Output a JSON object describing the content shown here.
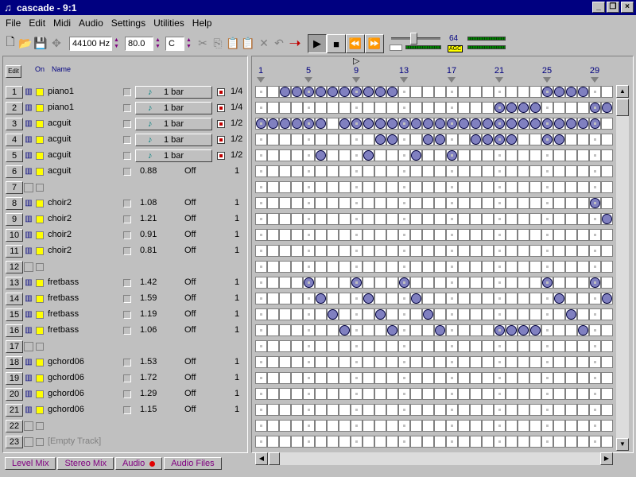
{
  "window": {
    "title": "cascade - 9:1"
  },
  "menu": [
    "File",
    "Edit",
    "Midi",
    "Audio",
    "Settings",
    "Utilities",
    "Help"
  ],
  "toolbar": {
    "sample_rate": "44100 Hz",
    "tempo": "80.0",
    "key": "C",
    "level_value": "64",
    "agc_label": "AGC"
  },
  "track_header": {
    "edit_label": "Edit",
    "on_label": "On",
    "name_label": "Name"
  },
  "tracks": [
    {
      "num": "1",
      "name": "piano1",
      "type": "midi",
      "len": "1 bar",
      "frac": "1/4"
    },
    {
      "num": "2",
      "name": "piano1",
      "type": "midi",
      "len": "1 bar",
      "frac": "1/4"
    },
    {
      "num": "3",
      "name": "acguit",
      "type": "midi",
      "len": "1 bar",
      "frac": "1/2"
    },
    {
      "num": "4",
      "name": "acguit",
      "type": "midi",
      "len": "1 bar",
      "frac": "1/2"
    },
    {
      "num": "5",
      "name": "acguit",
      "type": "midi",
      "len": "1 bar",
      "frac": "1/2"
    },
    {
      "num": "6",
      "name": "acguit",
      "type": "audio",
      "val": "0.88",
      "off": "Off",
      "one": "1"
    },
    {
      "num": "7",
      "name": "",
      "type": "none"
    },
    {
      "num": "8",
      "name": "choir2",
      "type": "audio",
      "val": "1.08",
      "off": "Off",
      "one": "1"
    },
    {
      "num": "9",
      "name": "choir2",
      "type": "audio",
      "val": "1.21",
      "off": "Off",
      "one": "1"
    },
    {
      "num": "10",
      "name": "choir2",
      "type": "audio",
      "val": "0.91",
      "off": "Off",
      "one": "1"
    },
    {
      "num": "11",
      "name": "choir2",
      "type": "audio",
      "val": "0.81",
      "off": "Off",
      "one": "1"
    },
    {
      "num": "12",
      "name": "",
      "type": "none"
    },
    {
      "num": "13",
      "name": "fretbass",
      "type": "audio",
      "val": "1.42",
      "off": "Off",
      "one": "1"
    },
    {
      "num": "14",
      "name": "fretbass",
      "type": "audio",
      "val": "1.59",
      "off": "Off",
      "one": "1"
    },
    {
      "num": "15",
      "name": "fretbass",
      "type": "audio",
      "val": "1.19",
      "off": "Off",
      "one": "1"
    },
    {
      "num": "16",
      "name": "fretbass",
      "type": "audio",
      "val": "1.06",
      "off": "Off",
      "one": "1"
    },
    {
      "num": "17",
      "name": "",
      "type": "none"
    },
    {
      "num": "18",
      "name": "gchord06",
      "type": "audio",
      "val": "1.53",
      "off": "Off",
      "one": "1"
    },
    {
      "num": "19",
      "name": "gchord06",
      "type": "audio",
      "val": "1.72",
      "off": "Off",
      "one": "1"
    },
    {
      "num": "20",
      "name": "gchord06",
      "type": "audio",
      "val": "1.29",
      "off": "Off",
      "one": "1"
    },
    {
      "num": "21",
      "name": "gchord06",
      "type": "audio",
      "val": "1.15",
      "off": "Off",
      "one": "1"
    },
    {
      "num": "22",
      "name": "",
      "type": "none"
    },
    {
      "num": "23",
      "name": "[Empty Track]",
      "type": "empty"
    }
  ],
  "grid": {
    "bar_labels": [
      {
        "col": 0,
        "label": "1"
      },
      {
        "col": 4,
        "label": "5"
      },
      {
        "col": 8,
        "label": "9"
      },
      {
        "col": 12,
        "label": "13"
      },
      {
        "col": 16,
        "label": "17"
      },
      {
        "col": 20,
        "label": "21"
      },
      {
        "col": 24,
        "label": "25"
      },
      {
        "col": 28,
        "label": "29"
      }
    ],
    "markers": [
      0,
      4,
      8,
      12,
      16,
      20,
      24,
      28
    ],
    "columns": 30,
    "patterns": [
      [
        2,
        3,
        4,
        5,
        6,
        7,
        8,
        9,
        10,
        11,
        24,
        25,
        26,
        27
      ],
      [
        20,
        21,
        22,
        23,
        28,
        29
      ],
      [
        0,
        1,
        2,
        3,
        4,
        5,
        7,
        8,
        9,
        10,
        11,
        12,
        13,
        14,
        15,
        16,
        17,
        18,
        19,
        20,
        21,
        22,
        23,
        24,
        25,
        26,
        27,
        28
      ],
      [
        10,
        11,
        14,
        15,
        18,
        19,
        20,
        21,
        24,
        25
      ],
      [
        5,
        9,
        13,
        16
      ],
      [],
      [],
      [
        28
      ],
      [
        29
      ],
      [],
      [],
      [],
      [
        4,
        8,
        12,
        24,
        28
      ],
      [
        5,
        9,
        13,
        25,
        29
      ],
      [
        6,
        10,
        14,
        26
      ],
      [
        7,
        11,
        15,
        20,
        21,
        22,
        23,
        27
      ],
      [],
      [],
      [],
      [],
      [],
      [],
      []
    ]
  },
  "bottom_tabs": [
    "Level Mix",
    "Stereo Mix",
    "Audio",
    "Audio Files"
  ]
}
